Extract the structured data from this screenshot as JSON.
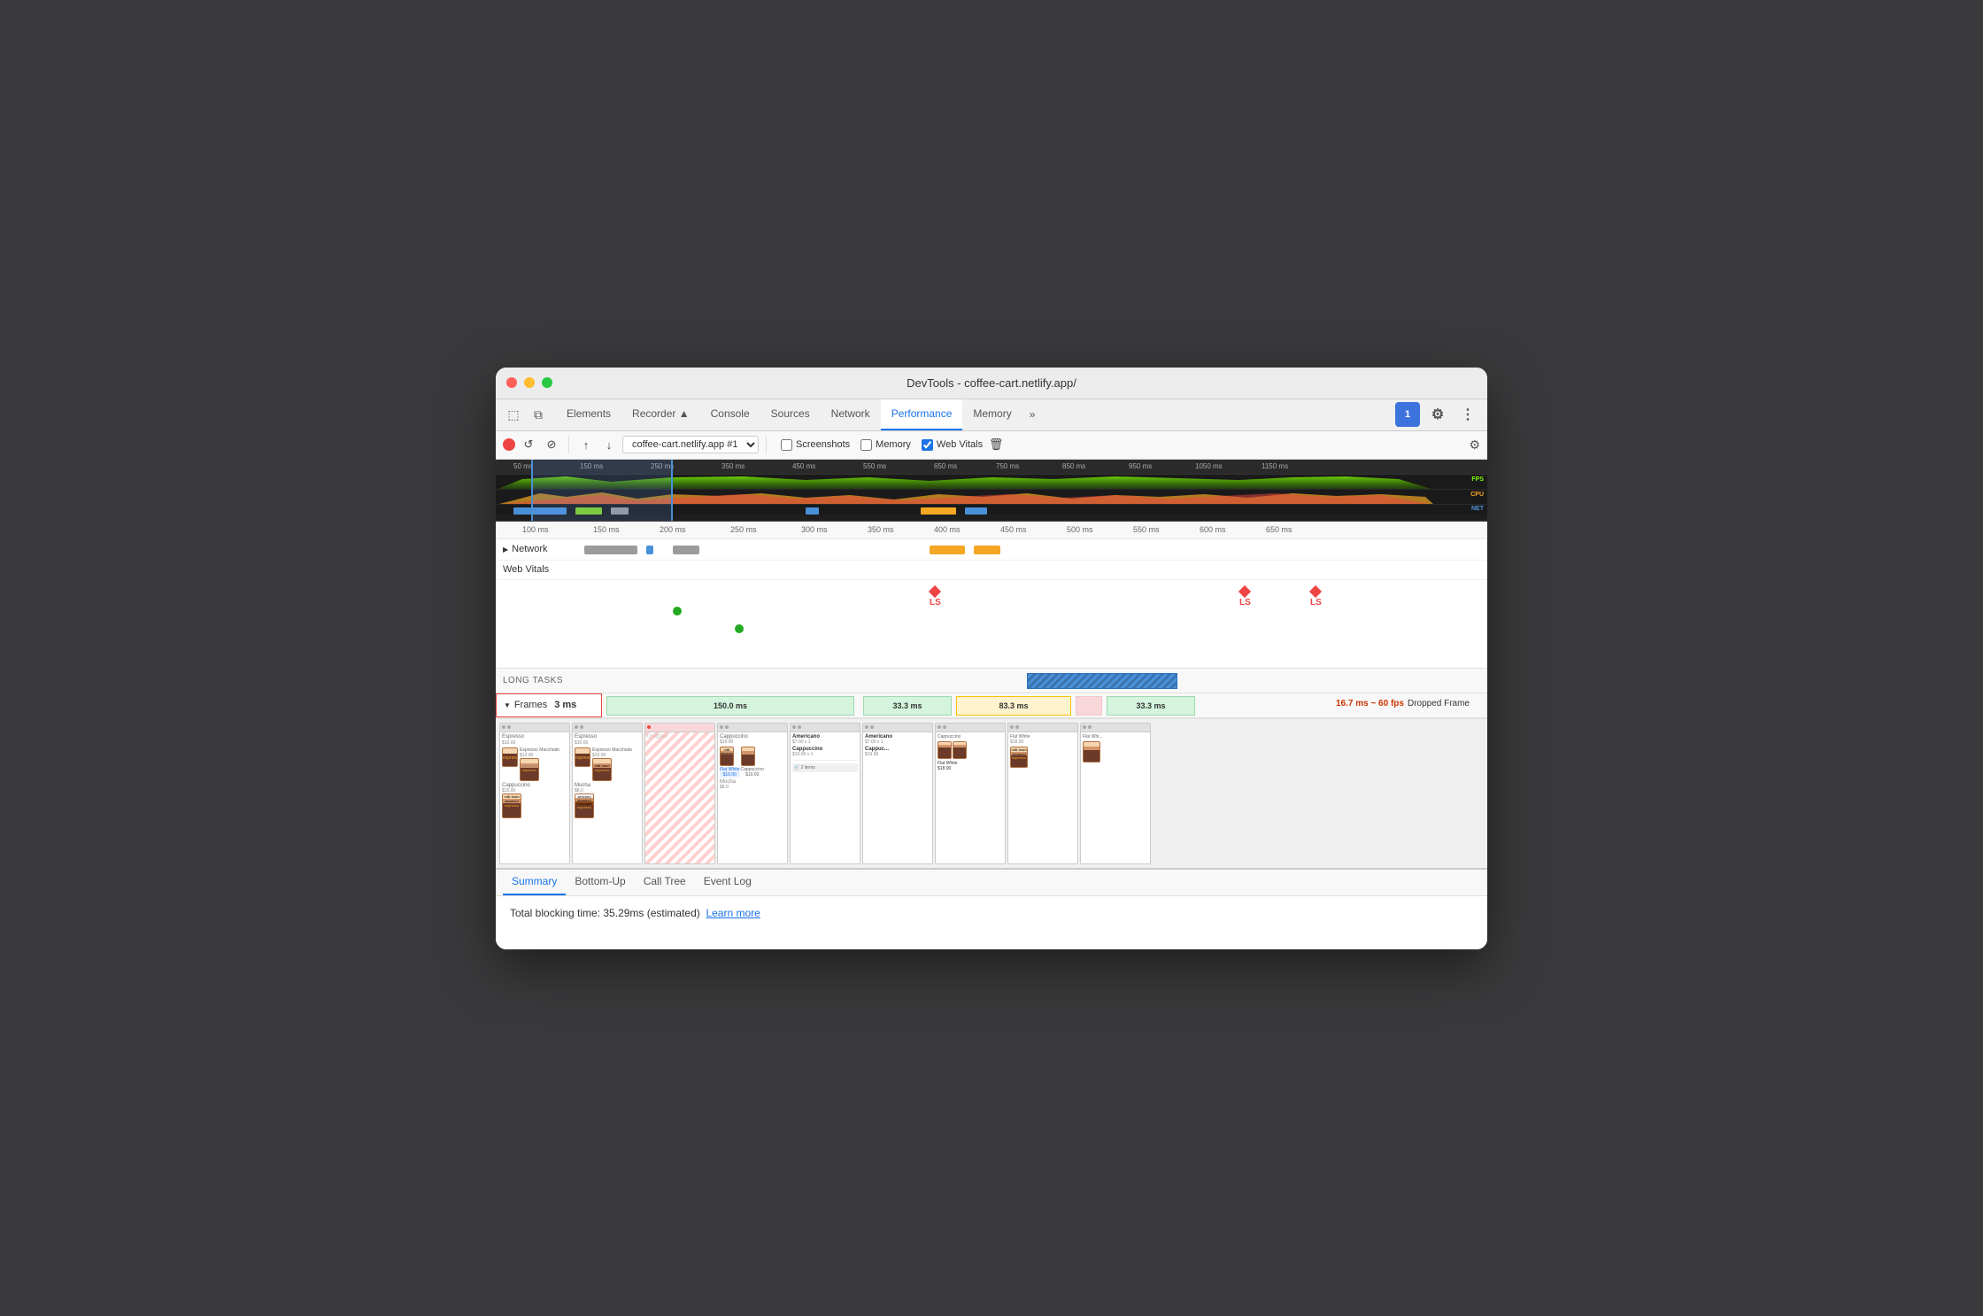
{
  "window": {
    "title": "DevTools - coffee-cart.netlify.app/"
  },
  "tabs": {
    "items": [
      {
        "id": "elements",
        "label": "Elements",
        "active": false
      },
      {
        "id": "recorder",
        "label": "Recorder ▲",
        "active": false
      },
      {
        "id": "console",
        "label": "Console",
        "active": false
      },
      {
        "id": "sources",
        "label": "Sources",
        "active": false
      },
      {
        "id": "network",
        "label": "Network",
        "active": false
      },
      {
        "id": "performance",
        "label": "Performance",
        "active": true
      },
      {
        "id": "memory",
        "label": "Memory",
        "active": false
      },
      {
        "id": "more",
        "label": "»",
        "active": false
      }
    ],
    "chat_badge": "1"
  },
  "toolbar": {
    "target": "coffee-cart.netlify.app #1",
    "screenshots_label": "Screenshots",
    "memory_label": "Memory",
    "web_vitals_label": "Web Vitals"
  },
  "overview": {
    "labels": [
      "50 ms",
      "150 ms",
      "250 ms",
      "350 ms",
      "450 ms",
      "550 ms",
      "650 ms",
      "750 ms",
      "850 ms",
      "950 ms",
      "1050 ms",
      "1150 ms"
    ],
    "fps_label": "FPS",
    "cpu_label": "CPU",
    "net_label": "NET"
  },
  "timeline": {
    "ruler_labels": [
      "100 ms",
      "150 ms",
      "200 ms",
      "250 ms",
      "300 ms",
      "350 ms",
      "400 ms",
      "450 ms",
      "500 ms",
      "550 ms",
      "600 ms",
      "650 ms"
    ],
    "network_label": "Network",
    "web_vitals_label": "Web Vitals",
    "long_tasks_label": "LONG TASKS",
    "frames_label": "Frames",
    "frames_ms": "3 ms",
    "frame_segments": [
      {
        "label": "150.0 ms",
        "type": "green"
      },
      {
        "label": "33.3 ms",
        "type": "green"
      },
      {
        "label": "83.3 ms",
        "type": "yellow"
      },
      {
        "label": "33.3 ms",
        "type": "green"
      }
    ],
    "ls_markers": [
      "LS",
      "LS",
      "LS"
    ],
    "dropped_fps": "16.7 ms ~ 60 fps",
    "dropped_label": "Dropped Frame"
  },
  "bottom_tabs": {
    "items": [
      {
        "id": "summary",
        "label": "Summary",
        "active": true
      },
      {
        "id": "bottom-up",
        "label": "Bottom-Up",
        "active": false
      },
      {
        "id": "call-tree",
        "label": "Call Tree",
        "active": false
      },
      {
        "id": "event-log",
        "label": "Event Log",
        "active": false
      }
    ]
  },
  "summary": {
    "text": "Total blocking time: 35.29ms (estimated)",
    "link_text": "Learn more"
  },
  "screenshots": {
    "items": [
      {
        "id": 1,
        "bar_color": "#4a90d9"
      },
      {
        "id": 2,
        "bar_color": "#7ed321"
      },
      {
        "id": 3,
        "bar_color": "#4a90d9"
      },
      {
        "id": 4,
        "bar_color": "#f5a623"
      },
      {
        "id": 5,
        "bar_color": "#e44"
      },
      {
        "id": 6,
        "bar_color": "#4a90d9"
      },
      {
        "id": 7,
        "bar_color": "#7ed321"
      },
      {
        "id": 8,
        "bar_color": "#4a90d9"
      },
      {
        "id": 9,
        "bar_color": "#f5a623"
      },
      {
        "id": 10,
        "bar_color": "#9b9b9b"
      },
      {
        "id": 11,
        "bar_color": "#4a90d9"
      },
      {
        "id": 12,
        "bar_color": "#7ed321"
      }
    ]
  }
}
